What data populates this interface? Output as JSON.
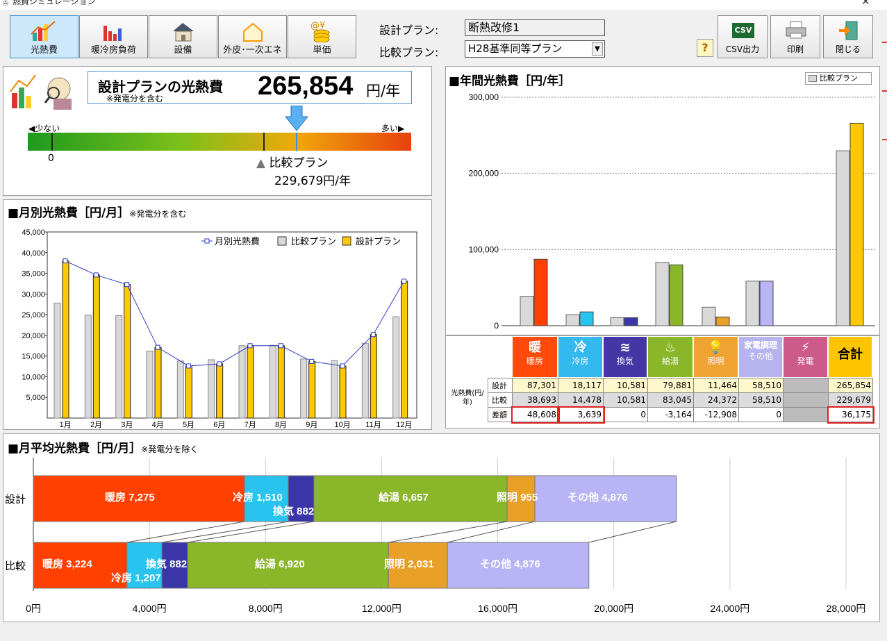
{
  "window": {
    "title": "燃費シミュレーション"
  },
  "toolbar": {
    "tabs": [
      {
        "label": "光熱費",
        "icon": "chart-bars-icon"
      },
      {
        "label": "暖冷房負荷",
        "icon": "bar-chart-icon"
      },
      {
        "label": "設備",
        "icon": "house-solar-icon"
      },
      {
        "label": "外皮･一次エネ",
        "icon": "house-outline-icon"
      },
      {
        "label": "単価",
        "icon": "coins-icon"
      }
    ],
    "plan_label": "設計プラン:",
    "plan_value": "断熱改修1",
    "compare_label": "比較プラン:",
    "compare_value": "H28基準同等プラン",
    "help": "?",
    "csv": "CSV出力",
    "csv_icon": "CSV",
    "print": "印刷",
    "close": "閉じる"
  },
  "summary": {
    "title": "設計プランの光熱費",
    "note": "※発電分を含む",
    "value": "265,854",
    "unit": "円/年",
    "less": "◀少ない",
    "more": "多い▶",
    "zero": "0",
    "compare_label": "比較プラン",
    "compare_value": "229,679円/年"
  },
  "monthly": {
    "title": "■月別光熱費［円/月］",
    "note": "※発電分を含む",
    "chart_data": {
      "type": "bar",
      "categories": [
        "1月",
        "2月",
        "3月",
        "4月",
        "5月",
        "6月",
        "7月",
        "8月",
        "9月",
        "10月",
        "11月",
        "12月"
      ],
      "series": [
        {
          "name": "比較プラン",
          "color": "#d9d9d9",
          "values": [
            27800,
            24900,
            24800,
            16200,
            13800,
            14100,
            17500,
            17600,
            14300,
            13900,
            18100,
            24500
          ]
        },
        {
          "name": "設計プラン",
          "color": "#ffc800",
          "values": [
            38000,
            34600,
            32300,
            17100,
            12600,
            13100,
            17500,
            17500,
            13700,
            12600,
            20200,
            33100
          ]
        },
        {
          "name": "月別光熱費",
          "color": "#2c3bbd",
          "values": [
            38000,
            34600,
            32300,
            17100,
            12600,
            13100,
            17500,
            17500,
            13700,
            12600,
            20200,
            33100
          ]
        }
      ],
      "ylim": [
        0,
        45000
      ],
      "yticks": [
        "45,000",
        "40,000",
        "35,000",
        "30,000",
        "25,000",
        "20,000",
        "15,000",
        "10,000",
        "5,000"
      ],
      "legend": [
        "月別光熱費",
        "比較プラン",
        "設計プラン"
      ]
    }
  },
  "annual": {
    "title": "■年間光熱費［円/年］",
    "legend": "比較プラン",
    "chart_data": {
      "type": "bar",
      "categories": [
        "暖房",
        "冷房",
        "換気",
        "給湯",
        "照明",
        "その他",
        "発電",
        "合計"
      ],
      "series": [
        {
          "name": "比較プラン",
          "values": [
            38693,
            14478,
            10581,
            83045,
            24372,
            58510,
            0,
            229679
          ]
        },
        {
          "name": "設計プラン",
          "values": [
            87301,
            18117,
            10581,
            79881,
            11464,
            58510,
            0,
            265854
          ]
        }
      ],
      "ylim": [
        0,
        300000
      ],
      "yticks": [
        "300,000",
        "200,000",
        "100,000",
        "0"
      ]
    },
    "colors": [
      "#ff4000",
      "#29c3f0",
      "#3a36a8",
      "#8ab62a",
      "#e8a026",
      "#b8b4f6",
      "#d9d9d9",
      "#ffc800"
    ]
  },
  "table": {
    "categories": [
      {
        "icon_text": "暖",
        "label": "暖房",
        "bg": "#ff4a0a"
      },
      {
        "icon_text": "冷",
        "label": "冷房",
        "bg": "#33b9ee"
      },
      {
        "icon_text": "≋",
        "label": "換気",
        "bg": "#4437a5"
      },
      {
        "icon_text": "♨",
        "label": "給湯",
        "bg": "#8ab62a"
      },
      {
        "icon_text": "💡",
        "label": "照明",
        "bg": "#efa331"
      },
      {
        "icon_text": "家電調理",
        "label": "その他",
        "bg": "#b7b3ef"
      },
      {
        "icon_text": "⚡",
        "label": "発電",
        "bg": "#cc5b8a"
      },
      {
        "icon_text": "合計",
        "label": "",
        "bg": "#ffc400"
      }
    ],
    "row_group": "光熱費(円/年)",
    "rows": [
      {
        "label": "設計",
        "bg": "#fff8cc",
        "values": [
          "87,301",
          "18,117",
          "10,581",
          "79,881",
          "11,464",
          "58,510",
          "",
          "265,854"
        ]
      },
      {
        "label": "比較",
        "bg": "#dcdcdc",
        "values": [
          "38,693",
          "14,478",
          "10,581",
          "83,045",
          "24,372",
          "58,510",
          "",
          "229,679"
        ]
      },
      {
        "label": "差額",
        "bg": "#ffffff",
        "values": [
          "48,608",
          "3,639",
          "0",
          "-3,164",
          "-12,908",
          "0",
          "",
          "36,175"
        ]
      }
    ]
  },
  "avg": {
    "title": "■月平均光熱費［円/月］",
    "note": "※発電分を除く",
    "chart_data": {
      "type": "bar",
      "orientation": "horizontal-stacked",
      "rows": [
        "設計",
        "比較"
      ],
      "series": [
        {
          "name": "暖房",
          "values": [
            7275,
            3224
          ]
        },
        {
          "name": "冷房",
          "values": [
            1510,
            1207
          ]
        },
        {
          "name": "換気",
          "values": [
            882,
            882
          ]
        },
        {
          "name": "給湯",
          "values": [
            6657,
            6920
          ]
        },
        {
          "name": "照明",
          "values": [
            955,
            2031
          ]
        },
        {
          "name": "その他",
          "values": [
            4876,
            4876
          ]
        }
      ],
      "xlim": [
        0,
        28000
      ],
      "xticks": [
        "0円",
        "4,000円",
        "8,000円",
        "12,000円",
        "16,000円",
        "20,000円",
        "24,000円",
        "28,000円"
      ]
    },
    "labels": [
      [
        "暖房 7,275",
        "冷房 1,510",
        "換気 882",
        "給湯 6,657",
        "照明 955",
        "その他 4,876"
      ],
      [
        "暖房 3,224",
        "冷房 1,207",
        "換気 882",
        "給湯 6,920",
        "照明 2,031",
        "その他 4,876"
      ]
    ]
  }
}
